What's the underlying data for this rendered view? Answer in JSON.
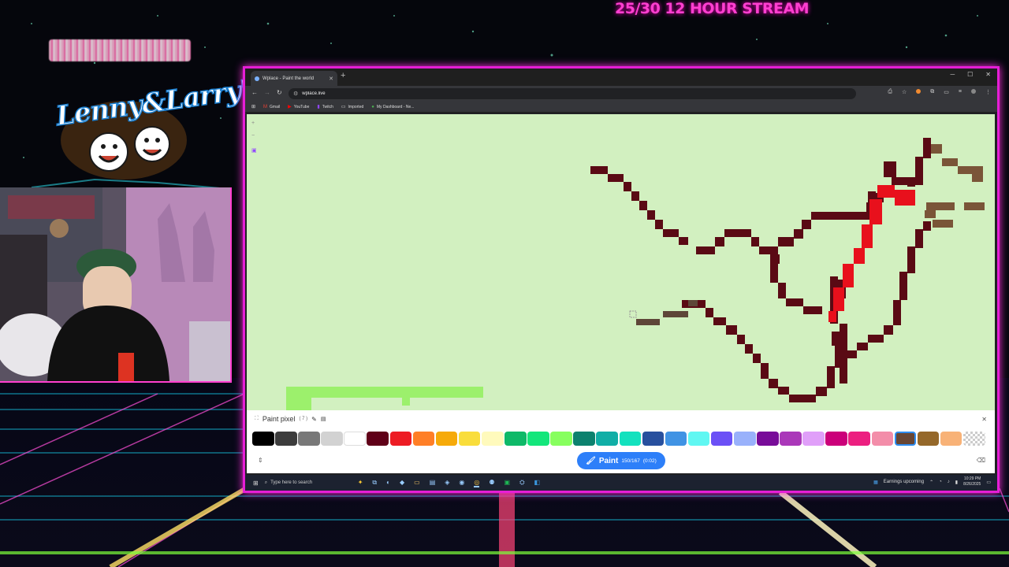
{
  "overlay": {
    "stream_title": "25/30 12 HOUR STREAM",
    "brand_logo_text": "Lenny&Larry's"
  },
  "browser": {
    "tab_title": "Wplace - Paint the world",
    "new_tab": "+",
    "address": "wplace.live",
    "bookmarks": [
      "Gmail",
      "YouTube",
      "Twitch",
      "Imported",
      "My Dashboard - Ne..."
    ]
  },
  "paint_panel": {
    "title": "Paint pixel",
    "subtitle": "( 7 )",
    "button_label": "Paint",
    "count": "150/167",
    "timer": "(0:02)",
    "colors": [
      "#000000",
      "#3c3c3c",
      "#787878",
      "#d2d2d2",
      "#ffffff",
      "#600018",
      "#ed1c24",
      "#ff7f27",
      "#f6aa09",
      "#f9dd3b",
      "#fffabc",
      "#0eb968",
      "#13e67b",
      "#87ff5e",
      "#0c816e",
      "#10aea6",
      "#13e1be",
      "#28509e",
      "#4093e4",
      "#60f7f2",
      "#6b50f6",
      "#99b1fb",
      "#780c99",
      "#aa38b9",
      "#e09ff9",
      "#cb007a",
      "#ec1f80",
      "#f38da9",
      "#684634",
      "#95682a",
      "#f8b277",
      "transparent"
    ],
    "selected_index": 28
  },
  "taskbar": {
    "search_placeholder": "Type here to search",
    "news": "Earnings upcoming",
    "time": "10:29 PM",
    "date": "8/26/2025"
  }
}
